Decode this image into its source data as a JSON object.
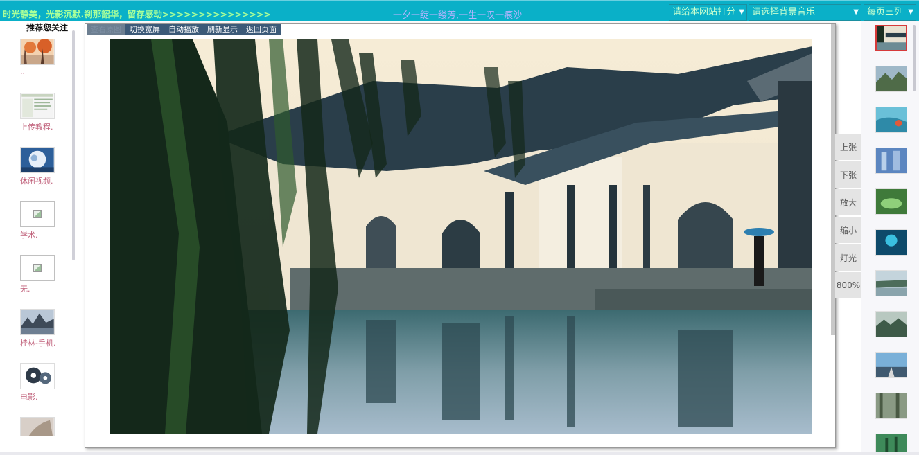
{
  "topbar": {
    "marquee": "时光静美，光影沉默.刹那韶华，留存感动>>>>>>>>>>>>>>>",
    "motto": "一夕一绽一缕芳,一生一叹一痕沙",
    "rate_select": "请给本网站打分",
    "music_select": "请选择背景音乐",
    "cols_select": "每页三列"
  },
  "left": {
    "title": "推荐您关注",
    "items": [
      {
        "label": ".."
      },
      {
        "label": "上传教程."
      },
      {
        "label": "休闲视频."
      },
      {
        "label": "学术."
      },
      {
        "label": "无."
      },
      {
        "label": "桂林-手机."
      },
      {
        "label": "电影."
      }
    ]
  },
  "toolbar": {
    "view_original": "查看原图",
    "toggle_wide": "切换宽屏",
    "autoplay": "自动播放",
    "refresh": "刷新显示",
    "back": "返回页面"
  },
  "controls": {
    "prev": "上张",
    "next": "下张",
    "zoom_in": "放大",
    "zoom_out": "缩小",
    "light": "灯光",
    "zoom_level": "800%"
  },
  "colors": {
    "topbar_bg": "#0ab0c8",
    "marquee": "#aaff99",
    "motto": "#b6b4ff",
    "label_pink": "#c0607a",
    "active_border": "#d63a3a"
  }
}
